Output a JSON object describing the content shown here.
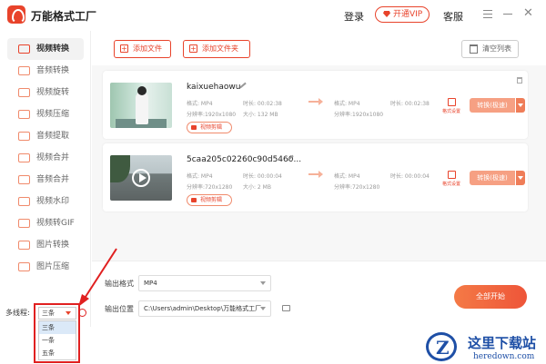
{
  "app": {
    "title": "万能格式工厂"
  },
  "titlebar": {
    "login": "登录",
    "vip": "开通VIP",
    "service": "客服"
  },
  "sidebar": {
    "items": [
      {
        "label": "视频转换",
        "active": true
      },
      {
        "label": "音频转换"
      },
      {
        "label": "视频旋转"
      },
      {
        "label": "视频压缩"
      },
      {
        "label": "音频提取"
      },
      {
        "label": "视频合并"
      },
      {
        "label": "音频合并"
      },
      {
        "label": "视频水印"
      },
      {
        "label": "视频转GIF"
      },
      {
        "label": "图片转换"
      },
      {
        "label": "图片压缩"
      }
    ]
  },
  "toolbar": {
    "add_file": "添加文件",
    "add_folder": "添加文件夹",
    "clear_list": "清空列表"
  },
  "files": [
    {
      "name": "kaixuehaowu",
      "src_format": "格式: MP4",
      "src_duration": "时长: 00:02:38",
      "src_resolution": "分辨率:1920x1080",
      "src_size": "大小: 132 MB",
      "out_format": "格式: MP4",
      "out_duration": "时长: 00:02:38",
      "out_resolution": "分辨率:1920x1080",
      "cut": "视频剪辑",
      "fmt_settings": "格式设置",
      "convert": "转换(极速)"
    },
    {
      "name": "5caa205c02260c90d5460...",
      "src_format": "格式: MP4",
      "src_duration": "时长: 00:00:04",
      "src_resolution": "分辨率:720x1280",
      "src_size": "大小: 2 MB",
      "out_format": "格式: MP4",
      "out_duration": "时长: 00:00:04",
      "out_resolution": "分辨率:720x1280",
      "cut": "视频剪辑",
      "fmt_settings": "格式设置",
      "convert": "转换(极速)"
    }
  ],
  "output": {
    "format_label": "输出格式",
    "format_value": "MP4",
    "location_label": "输出位置",
    "location_value": "C:\\Users\\admin\\Desktop\\万能格式工厂"
  },
  "start": "全部开始",
  "threads": {
    "label": "多线程:",
    "selected": "三条",
    "options": [
      "三条",
      "一条",
      "五条"
    ]
  },
  "watermark": {
    "text": "这里下载站",
    "url": "heredown.com"
  },
  "colors": {
    "accent": "#e8432b",
    "highlight_box": "#e02020",
    "watermark": "#1e4fa6"
  }
}
